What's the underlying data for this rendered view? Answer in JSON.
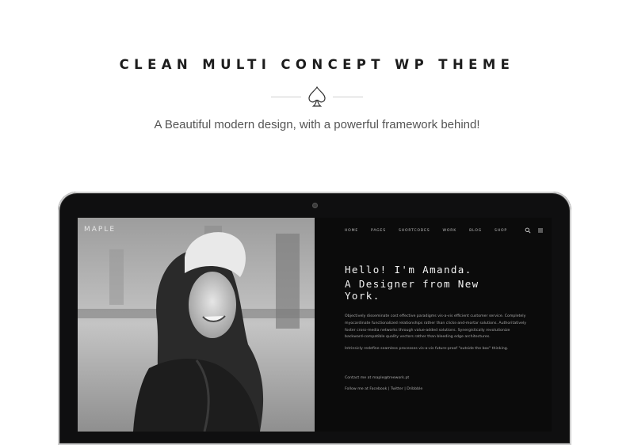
{
  "header": {
    "title": "CLEAN MULTI CONCEPT WP THEME",
    "subtitle": "A Beautiful modern design, with a powerful framework behind!",
    "ornament_icon": "spade-icon"
  },
  "device": {
    "logo": "MAPLE",
    "nav": {
      "items": [
        {
          "label": "HOME"
        },
        {
          "label": "PAGES"
        },
        {
          "label": "SHORTCODES"
        },
        {
          "label": "WORK"
        },
        {
          "label": "BLOG"
        },
        {
          "label": "SHOP"
        }
      ],
      "icons": [
        "search-icon",
        "menu-icon"
      ]
    },
    "hero": {
      "line1": "Hello! I'm Amanda.",
      "line2": "A Designer from New",
      "line3": "York."
    },
    "paragraphs": [
      "Objectively disseminate cost effective paradigms vis-a-vis efficient customer service. Completely myocardinate functionalized relationships rather than clicks-and-mortar solutions. Authoritatively foster cross-media networks through value-added solutions. Synergistically revolutionize backward-compatible quality vectors rather than bleeding edge architectures.",
      "Intrinsicly redefine seamless processes vis-a-vis future-proof \"outside the box\" thinking."
    ],
    "contact": {
      "label": "Contact me at",
      "email": "maple@treework.pt"
    },
    "follow": {
      "label": "Follow me at",
      "facebook": "Facebook",
      "separator": "|",
      "twitter": "Twitter",
      "dribbble": "Dribbble"
    }
  },
  "colors": {
    "background": "#ffffff",
    "device_body": "#0f0f10",
    "screen_bg": "#0b0b0b",
    "headline": "#1c1c1c",
    "subtitle": "#555555"
  }
}
